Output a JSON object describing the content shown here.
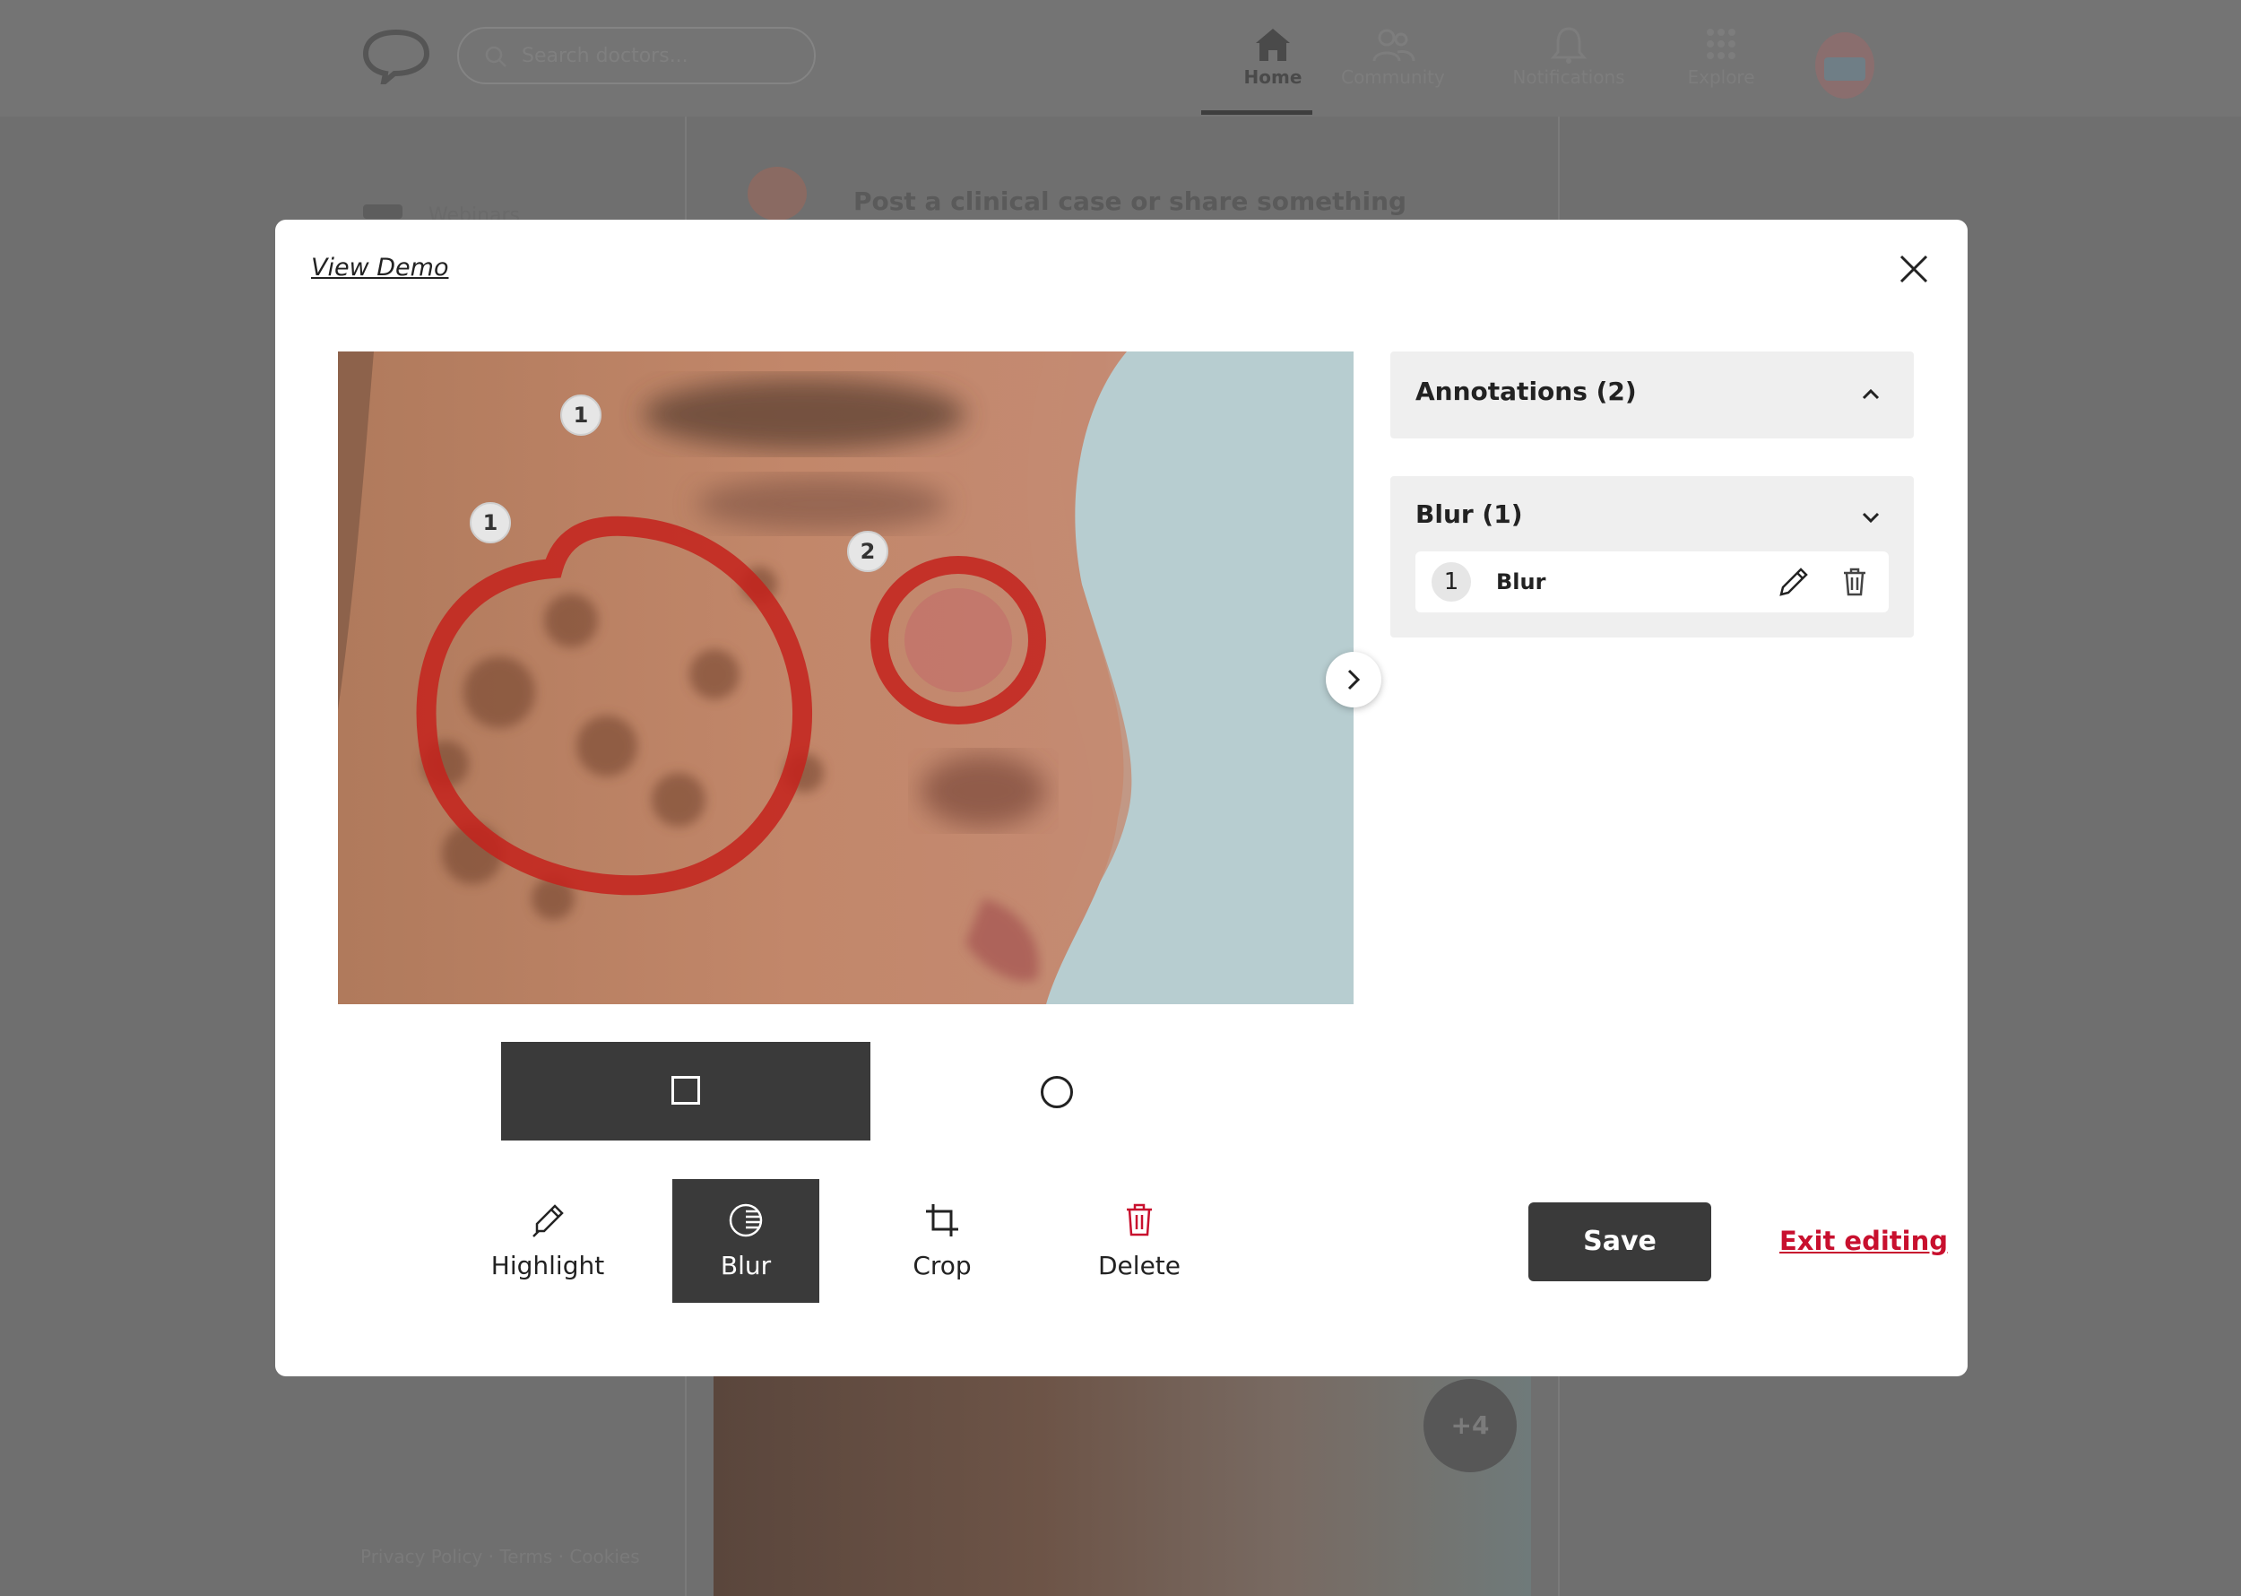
{
  "background": {
    "search_placeholder": "Search doctors...",
    "nav": [
      {
        "label": "Home"
      },
      {
        "label": "Community"
      },
      {
        "label": "Notifications"
      },
      {
        "label": "Explore"
      }
    ],
    "left_menu_item": "Webinars",
    "post_prompt": "Post a clinical case or share something",
    "photo_more_badge": "+4",
    "footer_links": "Privacy Policy · Terms · Cookies"
  },
  "modal": {
    "view_demo": "View Demo",
    "markers": [
      {
        "label": "1"
      },
      {
        "label": "1"
      },
      {
        "label": "2"
      }
    ],
    "tools": [
      {
        "label": "Highlight",
        "icon": "highlighter-icon",
        "active": false
      },
      {
        "label": "Blur",
        "icon": "blur-icon",
        "active": true
      },
      {
        "label": "Crop",
        "icon": "crop-icon",
        "active": false
      },
      {
        "label": "Delete",
        "icon": "trash-icon",
        "active": false
      }
    ],
    "shapes": [
      {
        "name": "rectangle",
        "active": true
      },
      {
        "name": "circle",
        "active": false
      }
    ],
    "save_label": "Save",
    "exit_label": "Exit editing",
    "annotations_panel": {
      "title": "Annotations (2)",
      "expanded": true
    },
    "blur_panel": {
      "title": "Blur (1)",
      "items": [
        {
          "number": "1",
          "label": "Blur"
        }
      ]
    }
  },
  "colors": {
    "accent_dark": "#3a3a3a",
    "danger": "#c8102e",
    "annotation_red": "#c4221c"
  }
}
